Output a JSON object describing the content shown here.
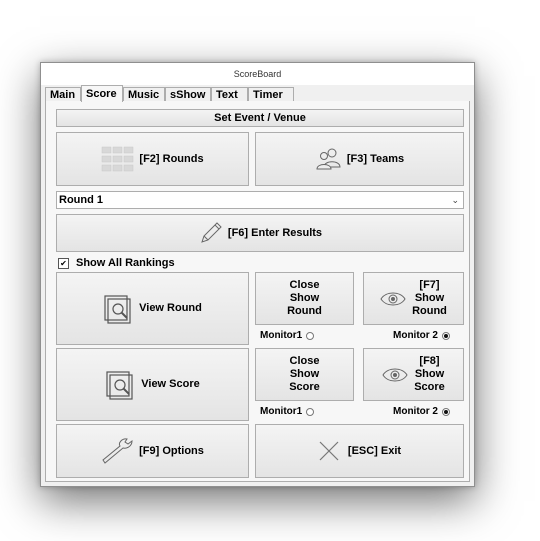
{
  "window": {
    "title": "ScoreBoard"
  },
  "tabs": [
    {
      "label": "Main",
      "active": false
    },
    {
      "label": "Score",
      "active": true
    },
    {
      "label": "Music",
      "active": false
    },
    {
      "label": "sShow",
      "active": false
    },
    {
      "label": "Text",
      "active": false
    },
    {
      "label": "Timer",
      "active": false
    }
  ],
  "score": {
    "set_event_label": "Set Event / Venue",
    "rounds_label": "[F2] Rounds",
    "teams_label": "[F3] Teams",
    "round_select": {
      "value": "Round 1"
    },
    "enter_results_label": "[F6] Enter Results",
    "show_all_rankings": {
      "label": "Show All Rankings",
      "checked": true
    },
    "view_round_label": "View Round",
    "close_show_round_label": "Close\nShow\nRound",
    "show_round_label": "[F7]\nShow\nRound",
    "round_monitor1_label": "Monitor1",
    "round_monitor2_label": "Monitor 2",
    "round_monitor_selected": "Monitor 2",
    "view_score_label": "View Score",
    "close_show_score_label": "Close\nShow\nScore",
    "show_score_label": "[F8]\nShow\nScore",
    "score_monitor1_label": "Monitor1",
    "score_monitor2_label": "Monitor 2",
    "score_monitor_selected": "Monitor 2",
    "options_label": "[F9] Options",
    "exit_label": "[ESC] Exit"
  },
  "icons": {
    "rounds": "grid-icon",
    "teams": "users-icon",
    "enter_results": "pencil-icon",
    "view": "magnifier-icon",
    "show": "eye-icon",
    "options": "wrench-icon",
    "exit": "close-icon"
  }
}
